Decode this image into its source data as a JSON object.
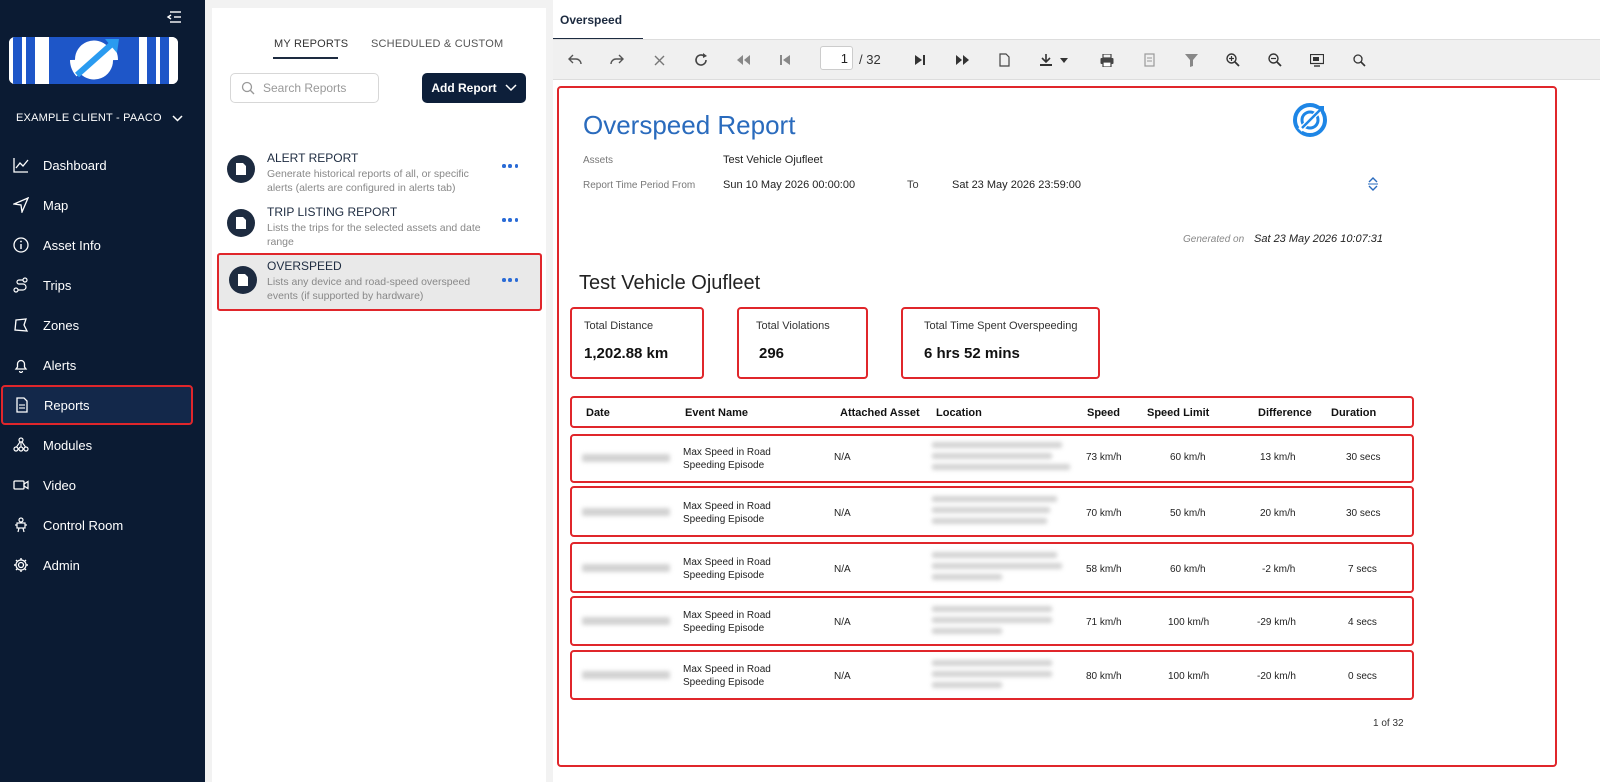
{
  "sidebar": {
    "client_name": "EXAMPLE CLIENT - PAACO",
    "nav": [
      {
        "label": "Dashboard",
        "icon": "chart-line-icon"
      },
      {
        "label": "Map",
        "icon": "navigation-arrow-icon"
      },
      {
        "label": "Asset Info",
        "icon": "info-circle-icon"
      },
      {
        "label": "Trips",
        "icon": "route-icon"
      },
      {
        "label": "Zones",
        "icon": "zone-icon"
      },
      {
        "label": "Alerts",
        "icon": "bell-icon"
      },
      {
        "label": "Reports",
        "icon": "document-icon",
        "active": true
      },
      {
        "label": "Modules",
        "icon": "modules-icon"
      },
      {
        "label": "Video",
        "icon": "video-camera-icon"
      },
      {
        "label": "Control Room",
        "icon": "control-room-icon"
      },
      {
        "label": "Admin",
        "icon": "gear-icon"
      }
    ]
  },
  "reports_panel": {
    "tabs": [
      "MY REPORTS",
      "SCHEDULED & CUSTOM"
    ],
    "search_placeholder": "Search Reports",
    "add_button": "Add Report",
    "items": [
      {
        "title": "ALERT REPORT",
        "description": "Generate historical reports of all, or specific alerts (alerts are configured in alerts tab)"
      },
      {
        "title": "TRIP LISTING REPORT",
        "description": "Lists the trips for the selected assets and date range"
      },
      {
        "title": "OVERSPEED",
        "description": "Lists any device and road-speed overspeed events (if supported by hardware)",
        "active": true
      }
    ]
  },
  "viewer": {
    "tab": "Overspeed",
    "toolbar": {
      "current_page": "1",
      "total_pages": "/ 32"
    },
    "report": {
      "title": "Overspeed Report",
      "assets_label": "Assets",
      "assets_value": "Test Vehicle Ojufleet",
      "period_label": "Report Time Period From",
      "period_from": "Sun 10 May 2026 00:00:00",
      "to_label": "To",
      "period_to": "Sat 23 May 2026 23:59:00",
      "generated_label": "Generated on",
      "generated_value": "Sat 23 May 2026 10:07:31",
      "asset_heading": "Test Vehicle Ojufleet",
      "cards": [
        {
          "label": "Total Distance",
          "value": "1,202.88 km"
        },
        {
          "label": "Total Violations",
          "value": "296"
        },
        {
          "label": "Total Time Spent Overspeeding",
          "value": "6 hrs 52 mins"
        }
      ],
      "columns": [
        "Date",
        "Event Name",
        "Attached Asset",
        "Location",
        "Speed",
        "Speed Limit",
        "Difference",
        "Duration"
      ],
      "rows": [
        {
          "event": "Max Speed in Road Speeding Episode",
          "asset": "N/A",
          "speed": "73 km/h",
          "limit": "60  km/h",
          "diff": "13  km/h",
          "duration": "30 secs"
        },
        {
          "event": "Max Speed in Road Speeding Episode",
          "asset": "N/A",
          "speed": "70 km/h",
          "limit": "50  km/h",
          "diff": "20  km/h",
          "duration": "30 secs"
        },
        {
          "event": "Max Speed in Road Speeding Episode",
          "asset": "N/A",
          "speed": "58 km/h",
          "limit": "60  km/h",
          "diff": "-2  km/h",
          "duration": "7 secs"
        },
        {
          "event": "Max Speed in Road Speeding Episode",
          "asset": "N/A",
          "speed": "71 km/h",
          "limit": "100  km/h",
          "diff": "-29  km/h",
          "duration": "4 secs"
        },
        {
          "event": "Max Speed in Road Speeding Episode",
          "asset": "N/A",
          "speed": "80 km/h",
          "limit": "100  km/h",
          "diff": "-20  km/h",
          "duration": "0 secs"
        }
      ],
      "page_count": "1 of 32"
    }
  },
  "colors": {
    "sidebar_bg": "#0b1b33",
    "accent_blue": "#2a6bbd",
    "highlight_red": "#e0262b",
    "button_dark": "#0d1f3a"
  }
}
